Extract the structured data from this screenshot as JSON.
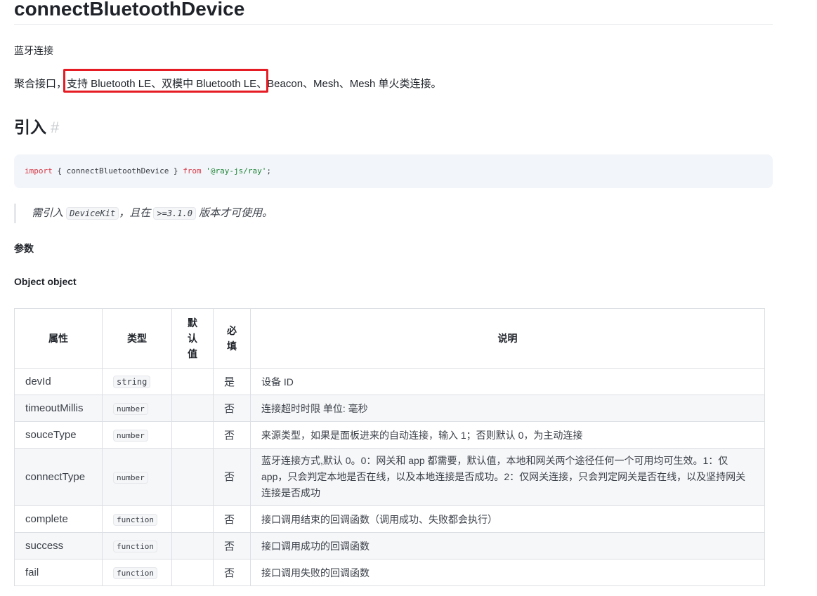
{
  "title": "connectBluetoothDevice",
  "subtitle": "蓝牙连接",
  "description": {
    "prefix": "聚合接口，",
    "highlight": "支持 Bluetooth LE、双模中 Bluetooth LE",
    "suffix": "、Beacon、Mesh、Mesh 单火类连接。"
  },
  "import_section": {
    "heading": "引入",
    "hash": "#",
    "code": {
      "kw_import": "import",
      "braces": " { connectBluetoothDevice } ",
      "kw_from": "from",
      "module": " '@ray-js/ray'",
      "end": ";"
    }
  },
  "note": {
    "prefix": "需引入 ",
    "kit": "DeviceKit",
    "middle": "，且在 ",
    "version": ">=3.1.0",
    "suffix": " 版本才可使用。"
  },
  "params_label": "参数",
  "object_label": "Object object",
  "table": {
    "headers": {
      "prop": "属性",
      "type": "类型",
      "default": "默认值",
      "required": "必填",
      "desc": "说明"
    },
    "rows": [
      {
        "name": "devId",
        "type": "string",
        "default": "",
        "required": "是",
        "desc": "设备 ID"
      },
      {
        "name": "timeoutMillis",
        "type": "number",
        "default": "",
        "required": "否",
        "desc": "连接超时时限 单位: 毫秒"
      },
      {
        "name": "souceType",
        "type": "number",
        "default": "",
        "required": "否",
        "desc": "来源类型，如果是面板进来的自动连接，输入 1；否则默认 0，为主动连接"
      },
      {
        "name": "connectType",
        "type": "number",
        "default": "",
        "required": "否",
        "desc": "蓝牙连接方式,默认 0。0：网关和 app 都需要，默认值，本地和网关两个途径任何一个可用均可生效。1：仅 app，只会判定本地是否在线，以及本地连接是否成功。2：仅网关连接，只会判定网关是否在线，以及坚持网关连接是否成功"
      },
      {
        "name": "complete",
        "type": "function",
        "default": "",
        "required": "否",
        "desc": "接口调用结束的回调函数（调用成功、失败都会执行）"
      },
      {
        "name": "success",
        "type": "function",
        "default": "",
        "required": "否",
        "desc": "接口调用成功的回调函数"
      },
      {
        "name": "fail",
        "type": "function",
        "default": "",
        "required": "否",
        "desc": "接口调用失败的回调函数"
      }
    ]
  },
  "colors": {
    "highlight_border": "#e51c23",
    "code_bg": "#f2f5f9",
    "keyword": "#d73a49",
    "string": "#22863a"
  }
}
